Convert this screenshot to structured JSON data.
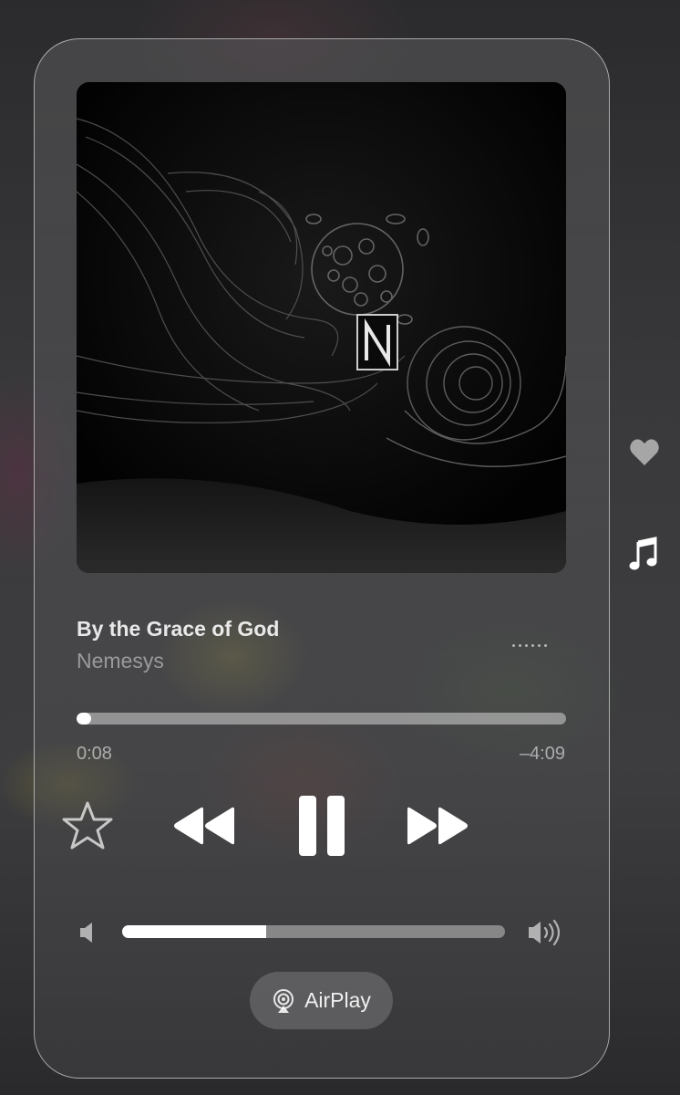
{
  "track": {
    "title": "By the Grace of God",
    "artist": "Nemesys"
  },
  "playback": {
    "elapsed": "0:08",
    "remaining": "–4:09",
    "progress_fraction": 0.03,
    "state": "playing"
  },
  "volume": {
    "level_fraction": 0.375
  },
  "airplay": {
    "label": "AirPlay"
  },
  "icons": {
    "favorite": "star-icon",
    "previous": "rewind-icon",
    "pause": "pause-icon",
    "next": "fast-forward-icon",
    "volume_low": "speaker-low-icon",
    "volume_high": "speaker-high-icon",
    "more": "more-dots-icon",
    "side_love": "heart-icon",
    "side_music": "music-note-icon"
  }
}
